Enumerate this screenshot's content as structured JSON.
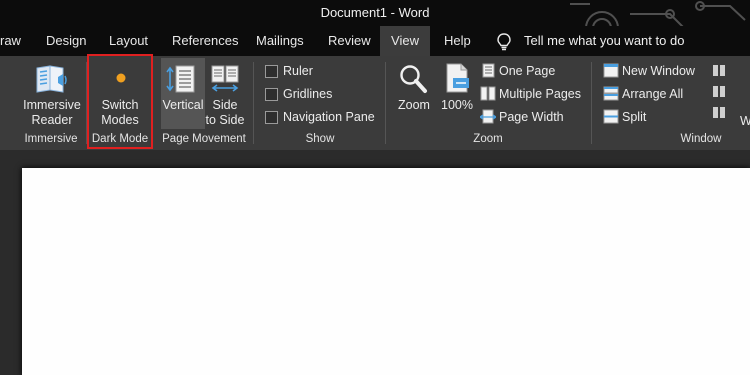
{
  "window": {
    "doc_title": "Document1  -  Word"
  },
  "tabs": [
    {
      "label": "raw"
    },
    {
      "label": "Design"
    },
    {
      "label": "Layout"
    },
    {
      "label": "References"
    },
    {
      "label": "Mailings"
    },
    {
      "label": "Review"
    },
    {
      "label": "View",
      "active": true
    },
    {
      "label": "Help"
    }
  ],
  "tell_me": {
    "text": "Tell me what you want to do"
  },
  "ribbon": {
    "immersive": {
      "group_label": "Immersive",
      "reader_line1": "Immersive",
      "reader_line2": "Reader"
    },
    "dark_mode": {
      "group_label": "Dark Mode",
      "switch_line1": "Switch",
      "switch_line2": "Modes",
      "highlight_color": "#e02020"
    },
    "page_movement": {
      "group_label": "Page Movement",
      "vertical": "Vertical",
      "side_line1": "Side",
      "side_line2": "to Side"
    },
    "show": {
      "group_label": "Show",
      "ruler": "Ruler",
      "gridlines": "Gridlines",
      "navigation_pane": "Navigation Pane"
    },
    "zoom": {
      "group_label": "Zoom",
      "zoom": "Zoom",
      "percent": "100%",
      "one_page": "One Page",
      "multiple_pages": "Multiple Pages",
      "page_width": "Page Width"
    },
    "window": {
      "group_label": "Window",
      "new_window": "New Window",
      "arrange_all": "Arrange All",
      "split": "Split",
      "cut_letter": "W"
    }
  },
  "colors": {
    "accent_blue": "#4a9fe0",
    "ribbon_bg": "#3b3b3b",
    "title_bg": "#0c0c0c"
  }
}
